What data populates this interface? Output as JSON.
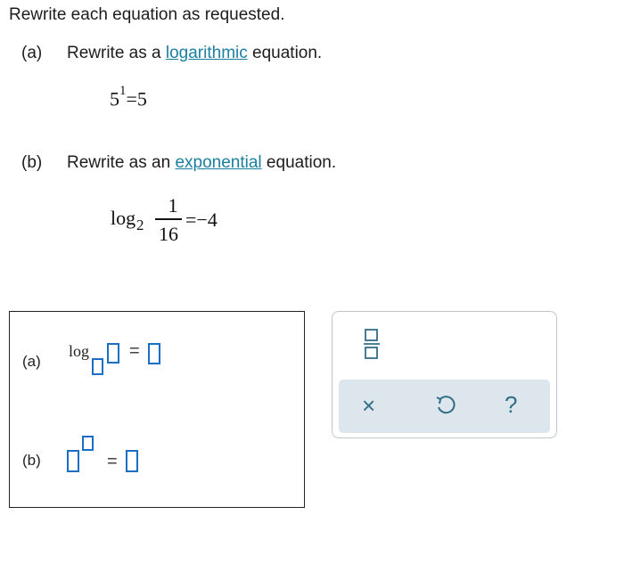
{
  "question": {
    "instruction": "Rewrite each equation as requested.",
    "part_a": {
      "label": "(a)",
      "prefix": "Rewrite as a ",
      "link": "logarithmic",
      "suffix": " equation.",
      "equation": {
        "base": "5",
        "exponent": "1",
        "rhs": "=5"
      }
    },
    "part_b": {
      "label": "(b)",
      "prefix": "Rewrite as an ",
      "link": "exponential",
      "suffix": " equation.",
      "equation": {
        "log": "log",
        "sub": "2",
        "numerator": "1",
        "denominator": "16",
        "rhs": "=−4"
      }
    }
  },
  "answer": {
    "a_label": "(a)",
    "a_log": "log",
    "equals": "=",
    "b_label": "(b)"
  },
  "palette": {
    "fraction_tool": "fraction-icon",
    "clear": "×",
    "undo": "undo-icon",
    "help": "?",
    "accent": "#2f6f88"
  }
}
